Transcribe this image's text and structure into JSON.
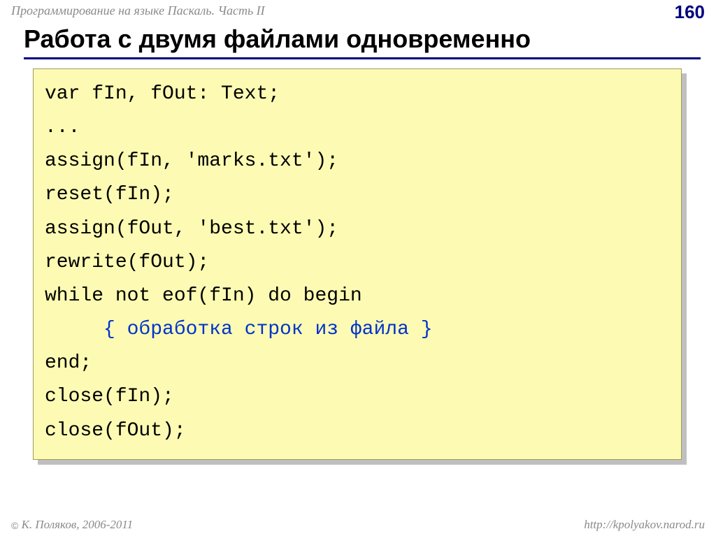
{
  "header": {
    "title": "Программирование на языке Паскаль. Часть II",
    "page_number": "160"
  },
  "title": "Работа с двумя файлами одновременно",
  "code": {
    "line1": "var fIn, fOut: Text;",
    "line2": "...",
    "line3": "assign(fIn, 'marks.txt');",
    "line4": "reset(fIn);",
    "line5": "assign(fOut, 'best.txt');",
    "line6": "rewrite(fOut);",
    "line7": "while not eof(fIn) do begin",
    "line8_indent": "     ",
    "line8_comment": "{ обработка строк из файла }",
    "line9": "end;",
    "line10": "close(fIn);",
    "line11": "close(fOut);"
  },
  "footer": {
    "copyright": " К. Поляков, 2006-2011",
    "url": "http://kpolyakov.narod.ru"
  }
}
